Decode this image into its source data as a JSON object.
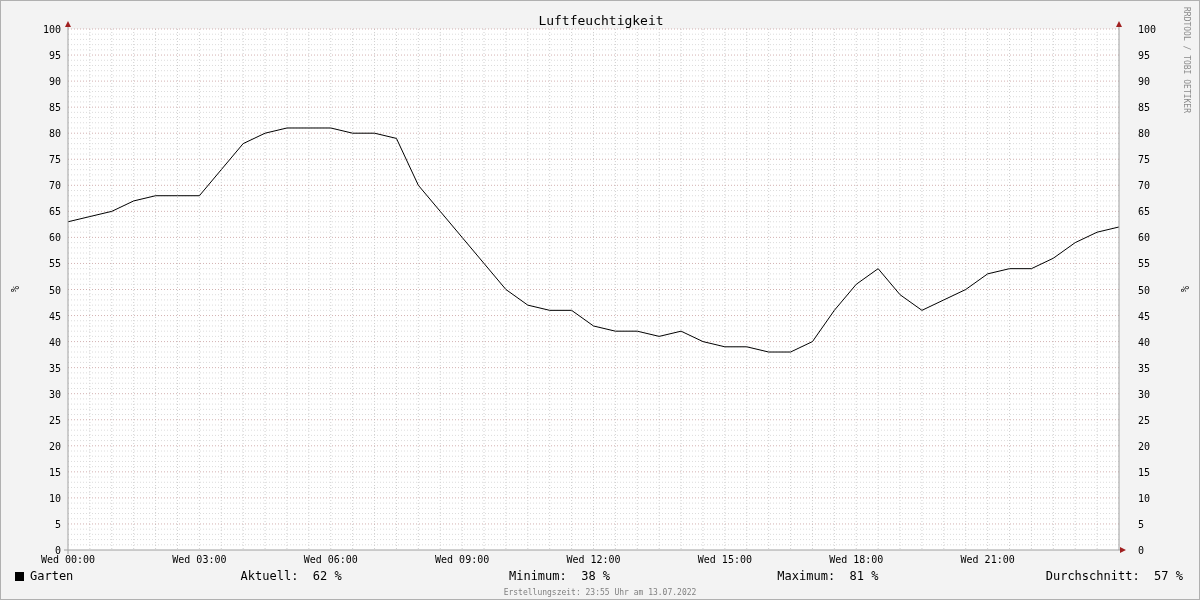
{
  "chart_data": {
    "type": "line",
    "title": "Luftfeuchtigkeit",
    "ylabel": "%",
    "categories": [
      "Wed 00:00",
      null,
      null,
      null,
      null,
      null,
      "Wed 03:00",
      null,
      null,
      null,
      null,
      null,
      "Wed 06:00",
      null,
      null,
      null,
      null,
      null,
      "Wed 09:00",
      null,
      null,
      null,
      null,
      null,
      "Wed 12:00",
      null,
      null,
      null,
      null,
      null,
      "Wed 15:00",
      null,
      null,
      null,
      null,
      null,
      "Wed 18:00",
      null,
      null,
      null,
      null,
      null,
      "Wed 21:00",
      null,
      null,
      null,
      null,
      null,
      null
    ],
    "series": [
      {
        "name": "Garten",
        "color": "#000000",
        "values": [
          63,
          64,
          65,
          67,
          68,
          68,
          68,
          73,
          78,
          80,
          81,
          81,
          81,
          80,
          80,
          79,
          70,
          65,
          60,
          55,
          50,
          47,
          46,
          46,
          43,
          42,
          42,
          41,
          42,
          40,
          39,
          39,
          38,
          38,
          40,
          46,
          51,
          54,
          49,
          46,
          48,
          50,
          53,
          54,
          54,
          56,
          59,
          61,
          62
        ]
      }
    ],
    "ylim": [
      0,
      100
    ],
    "grid": true,
    "yticks": [
      0,
      5,
      10,
      15,
      20,
      25,
      30,
      35,
      40,
      45,
      50,
      55,
      60,
      65,
      70,
      75,
      80,
      85,
      90,
      95,
      100
    ]
  },
  "right_axis": {
    "label": "%",
    "ticks": [
      "100",
      "95",
      "90",
      "85",
      "80",
      "75",
      "70",
      "65",
      "60",
      "55",
      "50",
      "45",
      "40",
      "35",
      "30",
      "25",
      "20",
      "15",
      "10",
      "5",
      "0"
    ]
  },
  "watermark_credit": "RRDTOOL / TOBI OETIKER",
  "legend": {
    "stats": [
      {
        "label": "Aktuell:",
        "value": "62 %"
      },
      {
        "label": "Minimum:",
        "value": "38 %"
      },
      {
        "label": "Maximum:",
        "value": "81 %"
      },
      {
        "label": "Durchschnitt:",
        "value": "57 %"
      }
    ]
  },
  "footer": "Erstellungszeit: 23:55 Uhr am 13.07.2022"
}
